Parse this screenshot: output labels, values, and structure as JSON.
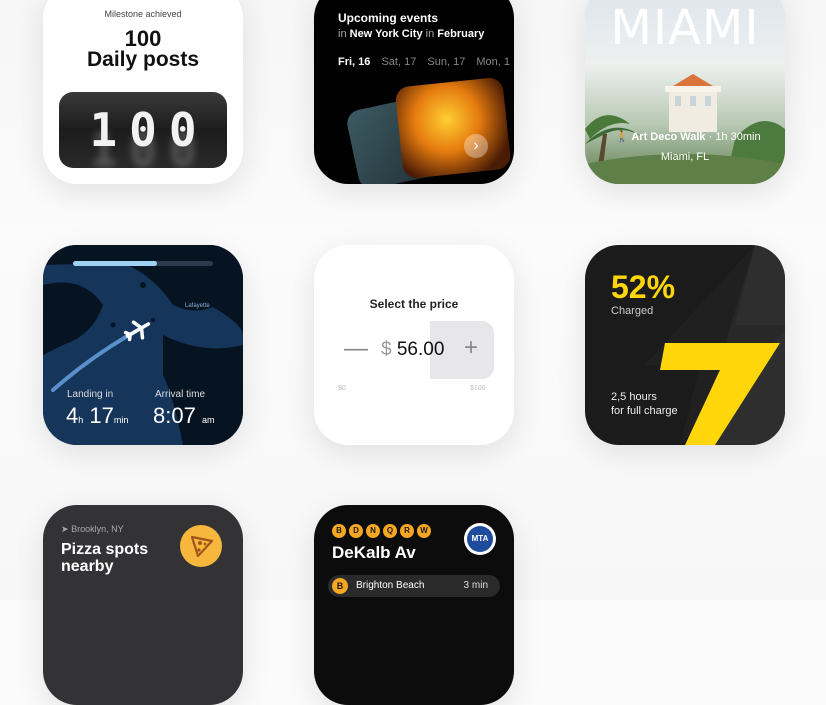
{
  "milestone": {
    "caption": "Milestone achieved",
    "number": "100",
    "label": "Daily posts",
    "digits": [
      "1",
      "0",
      "0"
    ]
  },
  "events": {
    "title": "Upcoming events",
    "sub_in": "in",
    "city": "New York City",
    "sub_in2": "in",
    "month": "February",
    "dates": [
      "Fri, 16",
      "Sat, 17",
      "Sun, 17",
      "Mon, 1"
    ],
    "arrow_icon": "chevron-right-icon"
  },
  "miami": {
    "title": "MIAMI",
    "walk_icon": "walking-person-icon",
    "walk": "Art Deco Walk",
    "duration": "· 1h 30min",
    "location": "Miami, FL"
  },
  "flight": {
    "progress": 0.6,
    "city_label": "Lafayette",
    "landing_label": "Landing in",
    "landing_h": "4",
    "landing_h_unit": "h",
    "landing_m": "17",
    "landing_m_unit": "min",
    "arrival_label": "Arrival time",
    "arrival_time": "8:07",
    "arrival_unit": "am"
  },
  "price": {
    "title": "Select the price",
    "currency": "$",
    "value": "56.00",
    "min": "$0",
    "max": "$100"
  },
  "battery": {
    "percent": "52%",
    "status": "Charged",
    "hours": "2,5 hours",
    "full": "for full charge",
    "accent": "#ffd60a"
  },
  "pizza": {
    "location_icon": "location-arrow-icon",
    "location": "Brooklyn, NY",
    "title_line1": "Pizza spots",
    "title_line2": "nearby",
    "icon": "pizza-slice-icon"
  },
  "subway": {
    "lines": [
      "B",
      "D",
      "N",
      "Q",
      "R",
      "W"
    ],
    "station": "DeKalb Av",
    "logo": "MTA",
    "next": {
      "line": "B",
      "destination": "Brighton Beach",
      "time": "3 min"
    }
  }
}
